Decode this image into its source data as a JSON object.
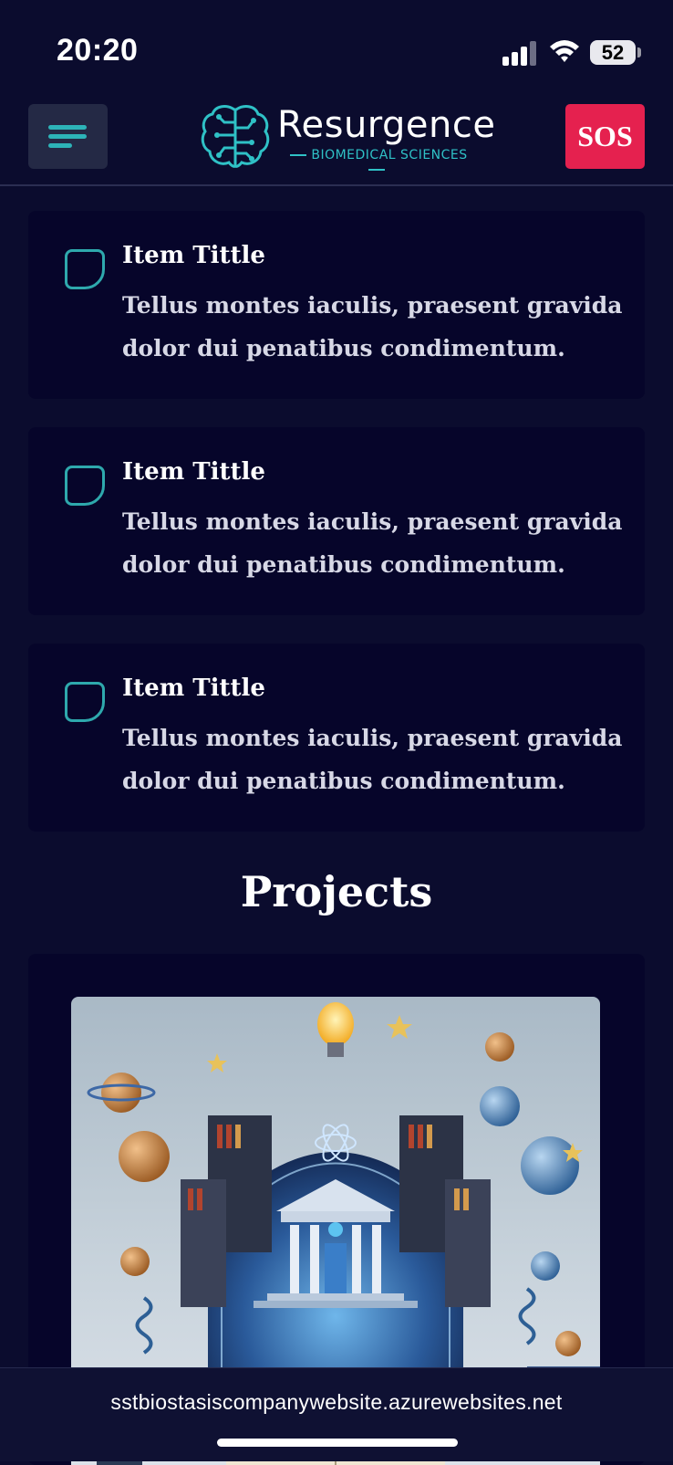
{
  "status_bar": {
    "time": "20:20",
    "battery": "52"
  },
  "header": {
    "brand_name": "Resurgence",
    "brand_subtitle": "BIOMEDICAL SCIENCES",
    "sos_label": "SOS",
    "accent_color": "#2db3b8",
    "sos_color": "#e5214f"
  },
  "items": [
    {
      "title": "Item Tittle",
      "description": "Tellus montes iaculis, praesent gravida dolor dui penatibus condimentum."
    },
    {
      "title": "Item Tittle",
      "description": "Tellus montes iaculis, praesent gravida dolor dui penatibus condimentum."
    },
    {
      "title": "Item Tittle",
      "description": "Tellus montes iaculis, praesent gravida dolor dui penatibus condimentum."
    }
  ],
  "projects": {
    "heading": "Projects"
  },
  "browser": {
    "url": "sstbiostasiscompanywebsite.azurewebsites.net"
  }
}
